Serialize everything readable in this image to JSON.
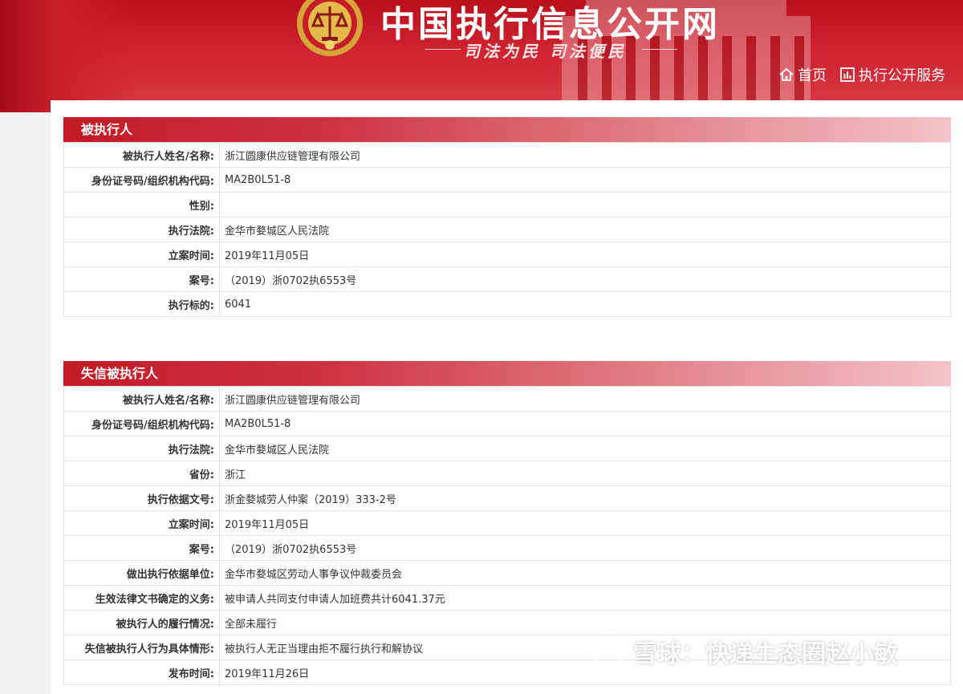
{
  "header": {
    "site_title": "中国执行信息公开网",
    "slogan": "司法为民    司法便民",
    "nav": [
      {
        "label": "首页",
        "icon": "home-icon"
      },
      {
        "label": "执行公开服务",
        "icon": "chart-icon"
      }
    ]
  },
  "colors": {
    "header_red": "#c41a27",
    "section_gradient_end": "#f4c3c8",
    "border": "#e3e3e3"
  },
  "sections": {
    "executed": {
      "title": "被执行人",
      "rows": [
        {
          "label": "被执行人姓名/名称:",
          "value": "浙江圆康供应链管理有限公司"
        },
        {
          "label": "身份证号码/组织机构代码:",
          "value": "MA2B0L51-8"
        },
        {
          "label": "性别:",
          "value": ""
        },
        {
          "label": "执行法院:",
          "value": "金华市婺城区人民法院"
        },
        {
          "label": "立案时间:",
          "value": "2019年11月05日"
        },
        {
          "label": "案号:",
          "value": "（2019）浙0702执6553号"
        },
        {
          "label": "执行标的:",
          "value": "6041"
        }
      ]
    },
    "dishonest": {
      "title": "失信被执行人",
      "rows": [
        {
          "label": "被执行人姓名/名称:",
          "value": "浙江圆康供应链管理有限公司"
        },
        {
          "label": "身份证号码/组织机构代码:",
          "value": "MA2B0L51-8"
        },
        {
          "label": "执行法院:",
          "value": "金华市婺城区人民法院"
        },
        {
          "label": "省份:",
          "value": "浙江"
        },
        {
          "label": "执行依据文号:",
          "value": "浙金婺城劳人仲案（2019）333-2号"
        },
        {
          "label": "立案时间:",
          "value": "2019年11月05日"
        },
        {
          "label": "案号:",
          "value": "（2019）浙0702执6553号"
        },
        {
          "label": "做出执行依据单位:",
          "value": "金华市婺城区劳动人事争议仲裁委员会"
        },
        {
          "label": "生效法律文书确定的义务:",
          "value": "被申请人共同支付申请人加班费共计6041.37元"
        },
        {
          "label": "被执行人的履行情况:",
          "value": "全部未履行"
        },
        {
          "label": "失信被执行人行为具体情形:",
          "value": "被执行人无正当理由拒不履行执行和解协议"
        },
        {
          "label": "发布时间:",
          "value": "2019年11月26日"
        }
      ]
    }
  },
  "watermark": {
    "text": "雪球：快递生态圈赵小敏"
  }
}
